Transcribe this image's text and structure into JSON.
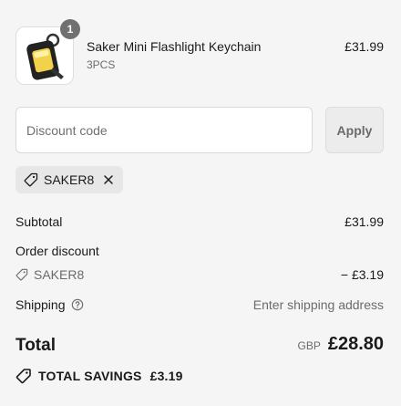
{
  "product": {
    "name": "Saker Mini Flashlight Keychain",
    "variant": "3PCS",
    "price": "£31.99",
    "quantity": "1",
    "image_icon": "flashlight-keychain-image"
  },
  "discount": {
    "placeholder": "Discount code",
    "apply_label": "Apply",
    "applied_code": "SAKER8"
  },
  "summary": {
    "subtotal_label": "Subtotal",
    "subtotal_value": "£31.99",
    "order_discount_label": "Order discount",
    "discount_code": "SAKER8",
    "discount_value": "− £3.19",
    "shipping_label": "Shipping",
    "shipping_value": "Enter shipping address",
    "total_label": "Total",
    "currency": "GBP",
    "total_value": "£28.80",
    "savings_label": "TOTAL SAVINGS",
    "savings_value": "£3.19"
  },
  "colors": {
    "background": "#f5f5f5",
    "badge": "#707070",
    "text": "#1a1a1a",
    "muted": "#6b6b6b"
  }
}
